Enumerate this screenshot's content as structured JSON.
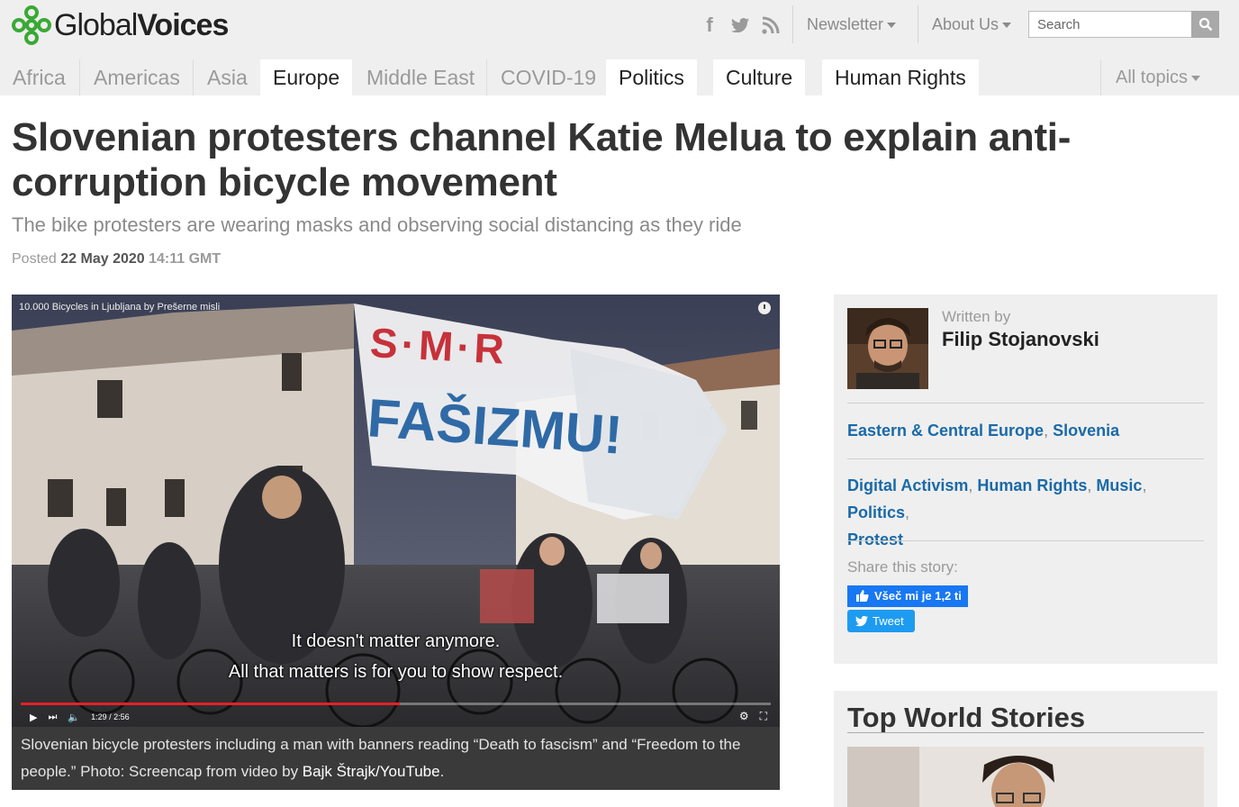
{
  "header": {
    "logo_light": "Global",
    "logo_bold": "Voices",
    "social": [
      "facebook-icon",
      "twitter-icon",
      "rss-icon"
    ],
    "newsletter_label": "Newsletter",
    "about_label": "About Us",
    "search_placeholder": "Search"
  },
  "nav": {
    "tabs": [
      {
        "label": "Africa",
        "active": false
      },
      {
        "label": "Americas",
        "active": false
      },
      {
        "label": "Asia",
        "active": false
      },
      {
        "label": "Europe",
        "active": true
      },
      {
        "label": "Middle East",
        "active": false
      },
      {
        "label": "COVID-19",
        "active": false
      },
      {
        "label": "Politics",
        "active": true
      },
      {
        "label": "Culture",
        "active": true
      },
      {
        "label": "Human Rights",
        "active": true
      }
    ],
    "all_topics": "All topics"
  },
  "article": {
    "title": "Slovenian protesters channel Katie Melua to explain anti-corruption bicycle movement",
    "subtitle": "The bike protesters are wearing masks and observing social distancing as they ride",
    "posted_label": "Posted",
    "date": "22 May 2020",
    "time": "14:11 GMT"
  },
  "video": {
    "title": "10.000 Bicycles in Ljubljana by Prešerne misli",
    "banner_text_1": "S·M·R",
    "banner_text_2": "FAŠIZMU!",
    "subtitle_line_1": "It doesn't matter anymore.",
    "subtitle_line_2": "All that matters is for you to show respect.",
    "time_display": "1:29 / 2:56",
    "progress": 0.505
  },
  "caption": {
    "text": "Slovenian bicycle protesters including a man with banners reading “Death to fascism” and “Freedom to the people.” Photo: Screencap from video by ",
    "link_text": "Bajk Štrajk/YouTube",
    "end": "."
  },
  "sidebar": {
    "written_by": "Written by",
    "author": "Filip Stojanovski",
    "regions": [
      "Eastern & Central Europe",
      "Slovenia"
    ],
    "topics": [
      "Digital Activism",
      "Human Rights",
      "Music",
      "Politics",
      "Protest"
    ],
    "share_label": "Share this story:",
    "fb_like": "Všeč mi je 1,2 ti",
    "tweet": "Tweet"
  },
  "top_stories": {
    "title": "Top World Stories"
  },
  "colors": {
    "link": "#1a6aa8",
    "logo_green": "#3aa935",
    "nav_bg": "#efefef",
    "progress_red": "#e4212a"
  }
}
